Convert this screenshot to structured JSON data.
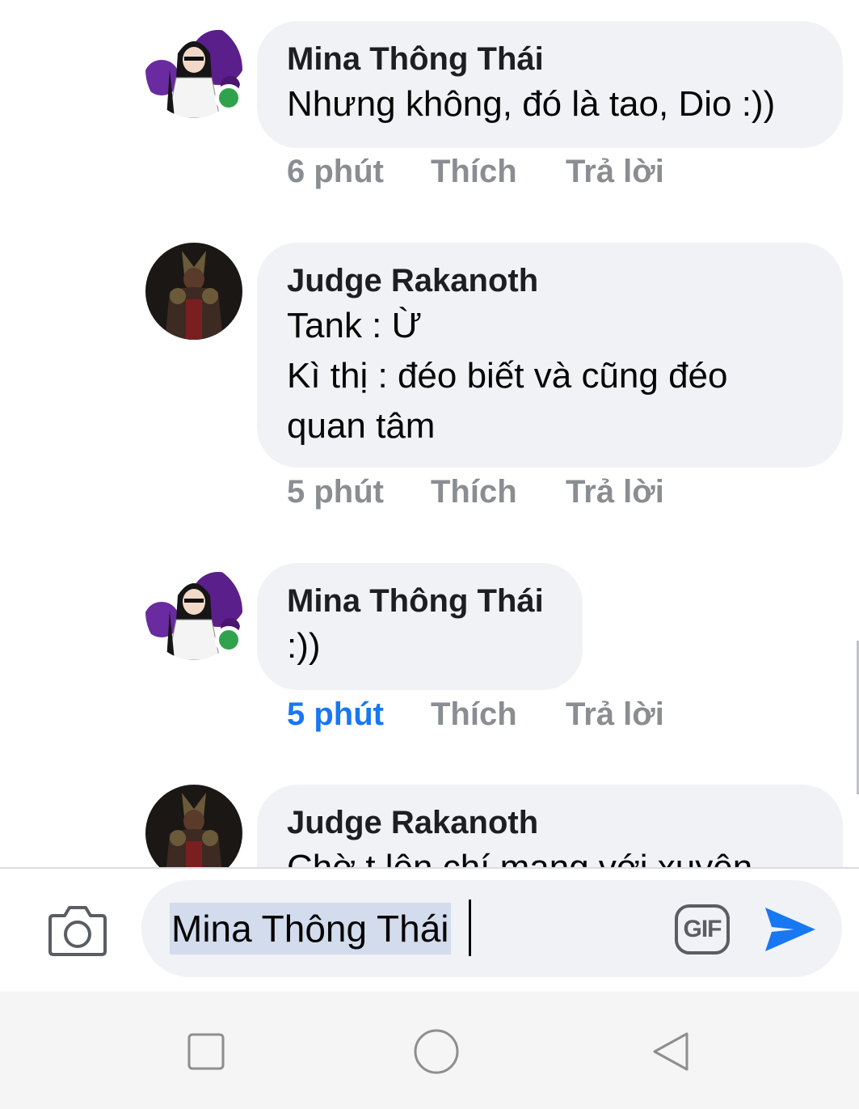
{
  "comments": [
    {
      "author": "Mina Thông Thái",
      "lines": [
        "Nhưng không, đó là tao, Dio :))"
      ],
      "time": "6 phút",
      "like": "Thích",
      "reply": "Trả lời",
      "online": true,
      "avatar": "anime-avatar"
    },
    {
      "author": "Judge Rakanoth",
      "lines": [
        "Tank : Ừ",
        "Kì thị : đéo biết và cũng đéo",
        "quan tâm"
      ],
      "time": "5 phút",
      "like": "Thích",
      "reply": "Trả lời",
      "online": false,
      "avatar": "warrior-avatar"
    },
    {
      "author": "Mina Thông Thái",
      "lines": [
        ":))"
      ],
      "time": "5 phút",
      "like": "Thích",
      "reply": "Trả lời",
      "online": true,
      "avatar": "anime-avatar",
      "time_highlighted": true
    },
    {
      "author": "Judge Rakanoth",
      "lines": [
        "Chờ t lên chí mạng với xuyên"
      ],
      "online": false,
      "avatar": "warrior-avatar"
    }
  ],
  "composer": {
    "value": "Mina Thông Thái",
    "camera_icon": "camera-icon",
    "gif_label": "GIF",
    "send_icon": "send-icon"
  },
  "navbar": {
    "icons": [
      "recent-apps-icon",
      "home-icon",
      "back-icon"
    ]
  },
  "colors": {
    "bubble": "#f0f2f5",
    "accent": "#1877f2",
    "online": "#31a24c",
    "meta": "#8a8d91"
  }
}
